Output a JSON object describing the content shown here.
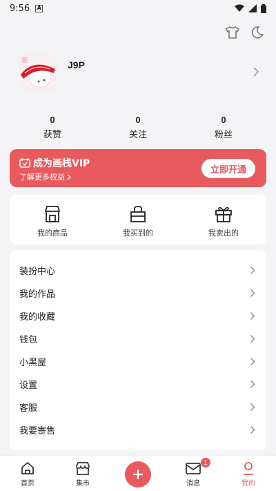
{
  "status_bar": {
    "time": "9:56",
    "notification_letter": "A"
  },
  "profile": {
    "username": "J9P"
  },
  "stats": [
    {
      "count": "0",
      "label": "获赞"
    },
    {
      "count": "0",
      "label": "关注"
    },
    {
      "count": "0",
      "label": "粉丝"
    }
  ],
  "vip": {
    "title": "成为画栈VIP",
    "subtitle": "了解更多权益",
    "button": "立即开通"
  },
  "quick_actions": [
    {
      "label": "我的商品",
      "icon": "shop-icon"
    },
    {
      "label": "我买到的",
      "icon": "bag-icon"
    },
    {
      "label": "我卖出的",
      "icon": "gift-icon"
    }
  ],
  "menu": [
    {
      "label": "装扮中心"
    },
    {
      "label": "我的作品"
    },
    {
      "label": "我的收藏"
    },
    {
      "label": "钱包"
    },
    {
      "label": "小黑屋"
    },
    {
      "label": "设置"
    },
    {
      "label": "客服"
    },
    {
      "label": "我要寄售"
    }
  ],
  "tabs": [
    {
      "label": "首页"
    },
    {
      "label": "集市"
    },
    {
      "label": ""
    },
    {
      "label": "消息",
      "badge": "1"
    },
    {
      "label": "我的"
    }
  ],
  "colors": {
    "accent": "#e85a5e",
    "background": "#f4f4f6"
  }
}
